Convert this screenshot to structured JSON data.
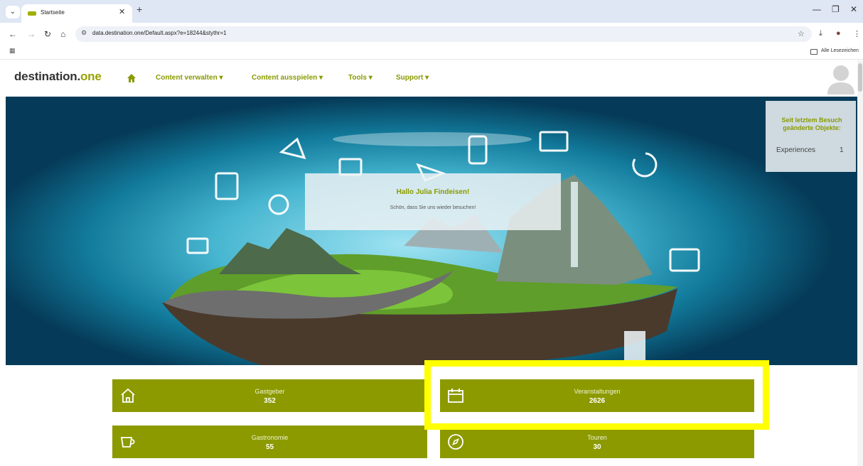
{
  "browser": {
    "tab_title": "Startseite",
    "new_tab": "+",
    "url": "data.destination.one/Default.aspx?e=18244&stythr=1",
    "bookmarks_label": "Alle Lesezeichen"
  },
  "site": {
    "logo_main": "destination.",
    "logo_accent": "one",
    "menu": [
      {
        "label": "Content verwalten ▾"
      },
      {
        "label": "Content ausspielen ▾"
      },
      {
        "label": "Tools ▾"
      },
      {
        "label": "Support ▾"
      }
    ],
    "welcome": {
      "title": "Hallo Julia Findeisen!",
      "subtitle": "Schön, dass Sie uns wieder besuchen!"
    },
    "changes": {
      "title": "Seit letztem Besuch geänderte Objekte:",
      "items": [
        {
          "label": "Experiences",
          "count": "1"
        }
      ]
    },
    "tiles": [
      {
        "label": "Gastgeber",
        "count": "352",
        "icon": "house-icon"
      },
      {
        "label": "Veranstaltungen",
        "count": "2626",
        "icon": "calendar-icon"
      },
      {
        "label": "Gastronomie",
        "count": "55",
        "icon": "cup-icon"
      },
      {
        "label": "Touren",
        "count": "30",
        "icon": "compass-icon"
      }
    ]
  },
  "colors": {
    "brand": "#8c9a00",
    "highlight": "#ffff00"
  }
}
